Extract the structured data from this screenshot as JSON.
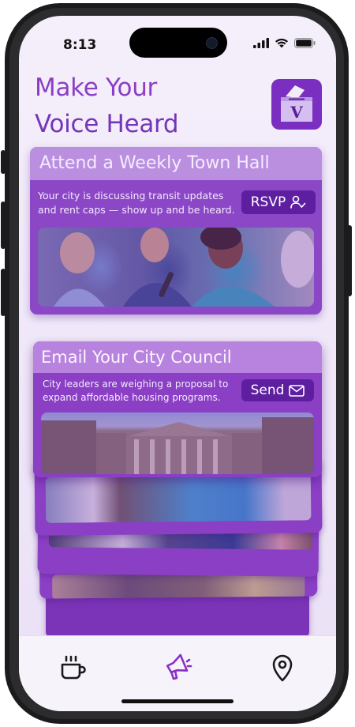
{
  "status_bar": {
    "time": "8:13"
  },
  "header": {
    "title_line1": "Make Your",
    "title_line2": "Voice Heard",
    "logo_letter": "V"
  },
  "cards": [
    {
      "title": "Attend a Weekly Town Hall",
      "description": "Your city is discussing transit updates and rent caps — show up and be heard.",
      "button_label": "RSVP",
      "button_icon": "user-check-icon"
    },
    {
      "title": "Email Your City Council",
      "description": "City leaders are weighing a proposal to expand affordable housing programs.",
      "button_label": "Send",
      "button_icon": "mail-icon"
    }
  ],
  "tab_bar": {
    "items": [
      {
        "icon": "coffee-cup-icon"
      },
      {
        "icon": "megaphone-icon",
        "active": true
      },
      {
        "icon": "location-pin-icon"
      }
    ]
  },
  "colors": {
    "primary": "#7a2fc0",
    "card": "#8a3fc4",
    "card_header": "#b883df",
    "button": "#5d1fa0",
    "screen_bg": "#f2eaf9"
  }
}
